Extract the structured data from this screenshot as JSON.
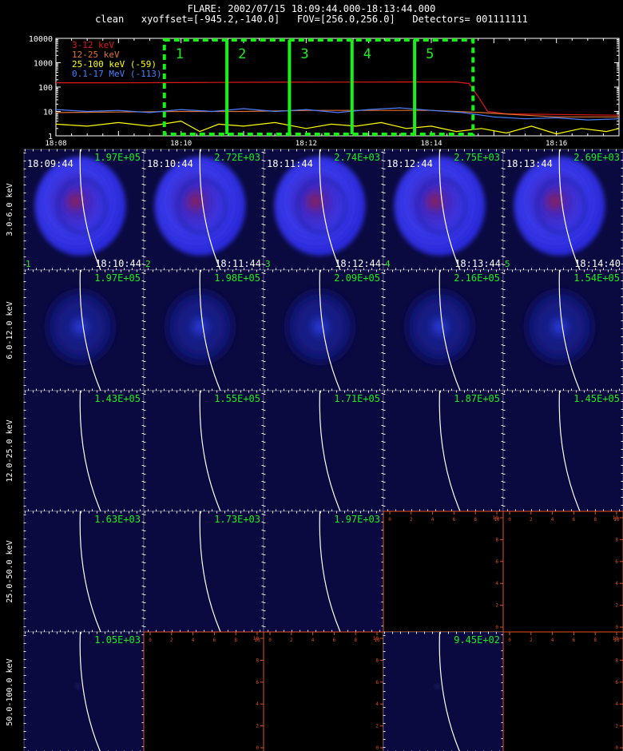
{
  "header": {
    "line1": "FLARE: 2002/07/15 18:09:44.000-18:13:44.000",
    "line2": "clean   xyoffset=[-945.2,-140.0]   FOV=[256.0,256.0]   Detectors= 001111111"
  },
  "colors": {
    "red": "#e01818",
    "orange": "#e07030",
    "yellow": "#ffff00",
    "blue": "#4a7fff",
    "green": "#18f018",
    "limb": "#ffffff"
  },
  "chart_data": [
    {
      "type": "line",
      "ylim": [
        1,
        10000
      ],
      "yscale": "log",
      "yticks": [
        "1",
        "10",
        "100",
        "1000",
        "10000"
      ],
      "xrange_min": [
        488,
        497
      ],
      "xticks": [
        {
          "min": 488,
          "label": "18:08"
        },
        {
          "min": 490,
          "label": "18:10"
        },
        {
          "min": 492,
          "label": "18:12"
        },
        {
          "min": 494,
          "label": "18:14"
        },
        {
          "min": 496,
          "label": "18:16"
        }
      ],
      "series": [
        {
          "name": "3-12 keV",
          "color": "#e01818",
          "points": [
            [
              488,
              150
            ],
            [
              488.9,
              150
            ],
            [
              489.5,
              152
            ],
            [
              490.5,
              155
            ],
            [
              491.5,
              158
            ],
            [
              492.5,
              160
            ],
            [
              493.5,
              162
            ],
            [
              494.4,
              162
            ],
            [
              494.6,
              140
            ],
            [
              494.75,
              40
            ],
            [
              494.9,
              10
            ],
            [
              495.2,
              8
            ],
            [
              496,
              7.5
            ],
            [
              497,
              7
            ]
          ]
        },
        {
          "name": "12-25 keV",
          "color": "#e07030",
          "points": [
            [
              488,
              9
            ],
            [
              489,
              9.5
            ],
            [
              490,
              10
            ],
            [
              491,
              10
            ],
            [
              492,
              11
            ],
            [
              493,
              11
            ],
            [
              494,
              11
            ],
            [
              494.8,
              9
            ],
            [
              495.5,
              7
            ],
            [
              496,
              6
            ],
            [
              497,
              6
            ]
          ]
        },
        {
          "name": "25-100 keV (-59)",
          "color": "#ffff00",
          "points": [
            [
              488,
              3
            ],
            [
              488.5,
              2.5
            ],
            [
              489,
              3.5
            ],
            [
              489.5,
              2.5
            ],
            [
              490,
              4
            ],
            [
              490.3,
              1.5
            ],
            [
              490.6,
              3
            ],
            [
              491,
              2.5
            ],
            [
              491.5,
              3.5
            ],
            [
              492,
              2
            ],
            [
              492.4,
              3
            ],
            [
              492.8,
              2.5
            ],
            [
              493.2,
              3.5
            ],
            [
              493.6,
              2
            ],
            [
              494,
              2.5
            ],
            [
              494.4,
              1.5
            ],
            [
              494.8,
              2
            ],
            [
              495.2,
              1.3
            ],
            [
              495.6,
              2.5
            ],
            [
              496,
              1.2
            ],
            [
              496.4,
              2
            ],
            [
              496.8,
              1.5
            ],
            [
              497,
              2
            ]
          ]
        },
        {
          "name": "0.1-17 MeV (-113)",
          "color": "#4a7fff",
          "points": [
            [
              488,
              12
            ],
            [
              488.5,
              10
            ],
            [
              489,
              11
            ],
            [
              489.5,
              9
            ],
            [
              490,
              12
            ],
            [
              490.5,
              10
            ],
            [
              491,
              13
            ],
            [
              491.5,
              10
            ],
            [
              492,
              12
            ],
            [
              492.5,
              9
            ],
            [
              493,
              12
            ],
            [
              493.5,
              14
            ],
            [
              494,
              11
            ],
            [
              494.5,
              9
            ],
            [
              495,
              6
            ],
            [
              495.5,
              5
            ],
            [
              496,
              5.5
            ],
            [
              496.5,
              4.5
            ],
            [
              497,
              5
            ]
          ]
        }
      ],
      "intervals": [
        {
          "label": "1",
          "start": 489.733,
          "end": 490.733
        },
        {
          "label": "2",
          "start": 490.733,
          "end": 491.733
        },
        {
          "label": "3",
          "start": 491.733,
          "end": 492.733
        },
        {
          "label": "4",
          "start": 492.733,
          "end": 493.733
        },
        {
          "label": "5",
          "start": 493.733,
          "end": 494.667
        }
      ]
    },
    {
      "type": "heatmap",
      "bands": [
        "3.0-6.0 keV",
        "6.0-12.0 keV",
        "12.0-25.0 keV",
        "25.0-50.0 keV",
        "50.0-100.0 keV"
      ],
      "times_start": [
        "18:09:44",
        "18:10:44",
        "18:11:44",
        "18:12:44",
        "18:13:44"
      ],
      "times_end": [
        "18:10:44",
        "18:11:44",
        "18:12:44",
        "18:13:44",
        "18:14:40"
      ],
      "panel_numbers": [
        "1",
        "2",
        "3",
        "4",
        "5"
      ],
      "empty_axis_ticks": [
        "0",
        "2",
        "4",
        "6",
        "8",
        "10"
      ],
      "maxima": [
        [
          "1.97E+05",
          "2.72E+03",
          "2.74E+03",
          "2.75E+03",
          "2.69E+03"
        ],
        [
          "1.97E+05",
          "1.98E+05",
          "2.09E+05",
          "2.16E+05",
          "1.54E+05"
        ],
        [
          "1.43E+05",
          "1.55E+05",
          "1.71E+05",
          "1.87E+05",
          "1.45E+05"
        ],
        [
          "1.63E+03",
          "1.73E+03",
          "1.97E+03",
          null,
          null
        ],
        [
          "1.05E+03",
          null,
          null,
          "9.45E+02",
          null
        ]
      ],
      "intensity": [
        [
          0.95,
          0.95,
          0.95,
          0.95,
          0.9
        ],
        [
          0.45,
          0.4,
          0.42,
          0.45,
          0.4
        ],
        [
          0.0,
          0.0,
          0.0,
          0.0,
          0.0
        ],
        [
          0.0,
          0.0,
          0.0,
          0.0,
          0.0
        ],
        [
          0.05,
          0.0,
          0.0,
          0.04,
          0.0
        ]
      ]
    }
  ]
}
